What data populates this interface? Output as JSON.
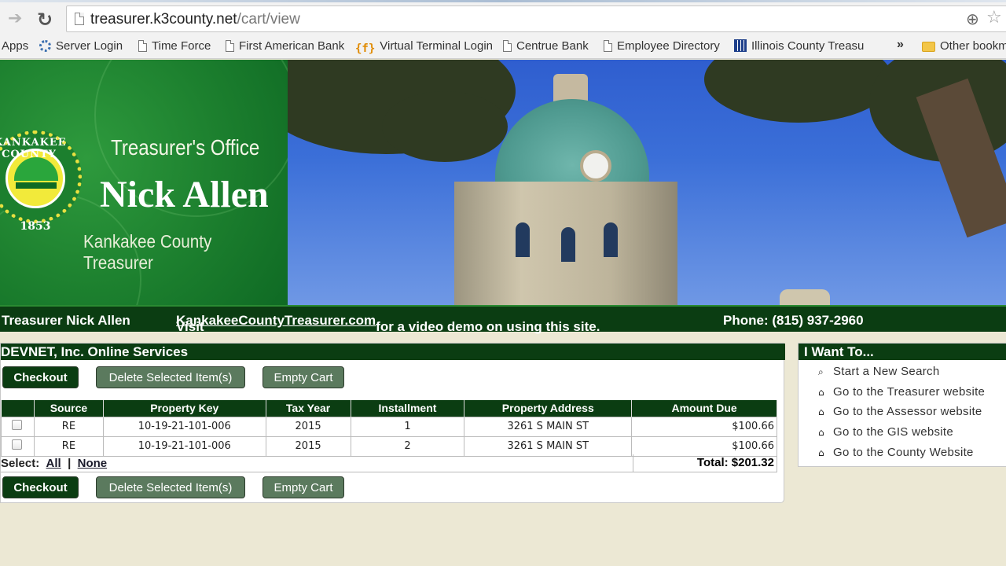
{
  "browser": {
    "url_host": "treasurer.k3county.net",
    "url_path": "/cart/view",
    "bookmarks": [
      {
        "label": "Apps",
        "icon": "apps-icon"
      },
      {
        "label": "Server Login",
        "icon": "gear-icon"
      },
      {
        "label": "Time Force",
        "icon": "page-icon"
      },
      {
        "label": "First American Bank",
        "icon": "page-icon"
      },
      {
        "label": "Virtual Terminal Login",
        "icon": "function-icon"
      },
      {
        "label": "Centrue Bank",
        "icon": "page-icon"
      },
      {
        "label": "Employee Directory",
        "icon": "page-icon"
      },
      {
        "label": "Illinois County Treasu",
        "icon": "grid-icon"
      },
      {
        "label": "Other bookm",
        "icon": "folder-icon"
      }
    ],
    "overflow": "»"
  },
  "banner": {
    "office": "Treasurer's Office",
    "name": "Nick Allen",
    "subtitle": "Kankakee County Treasurer",
    "seal_top": "KANKAKEE COUNTY",
    "seal_year": "1853"
  },
  "infobar": {
    "treasurer": "Treasurer Nick Allen",
    "visit_prefix": "Visit",
    "visit_link": "KankakeeCountyTreasurer.com",
    "visit_suffix": "for a video demo on using this site.",
    "phone": "Phone: (815) 937-2960"
  },
  "cart": {
    "heading": "DEVNET, Inc. Online Services",
    "buttons": {
      "checkout": "Checkout",
      "delete": "Delete Selected Item(s)",
      "empty": "Empty Cart"
    },
    "columns": [
      "Source",
      "Property Key",
      "Tax Year",
      "Installment",
      "Property Address",
      "Amount Due"
    ],
    "rows": [
      {
        "source": "RE",
        "key": "10-19-21-101-006",
        "year": "2015",
        "installment": "1",
        "address": "3261 S MAIN ST",
        "amount": "$100.66"
      },
      {
        "source": "RE",
        "key": "10-19-21-101-006",
        "year": "2015",
        "installment": "2",
        "address": "3261 S MAIN ST",
        "amount": "$100.66"
      }
    ],
    "select_label": "Select:",
    "select_all": "All",
    "select_sep": "|",
    "select_none": "None",
    "total": "Total: $201.32"
  },
  "side": {
    "heading": "I Want To...",
    "items": [
      {
        "label": "Start a New Search",
        "icon": "search-icon"
      },
      {
        "label": "Go to the Treasurer website",
        "icon": "home-icon"
      },
      {
        "label": "Go to the Assessor website",
        "icon": "home-icon"
      },
      {
        "label": "Go to the GIS website",
        "icon": "home-icon"
      },
      {
        "label": "Go to the County Website",
        "icon": "home-icon"
      }
    ]
  },
  "colors": {
    "header_green": "#0b3d12",
    "button_mid": "#5b7a5e",
    "page_bg": "#ece8d4"
  }
}
